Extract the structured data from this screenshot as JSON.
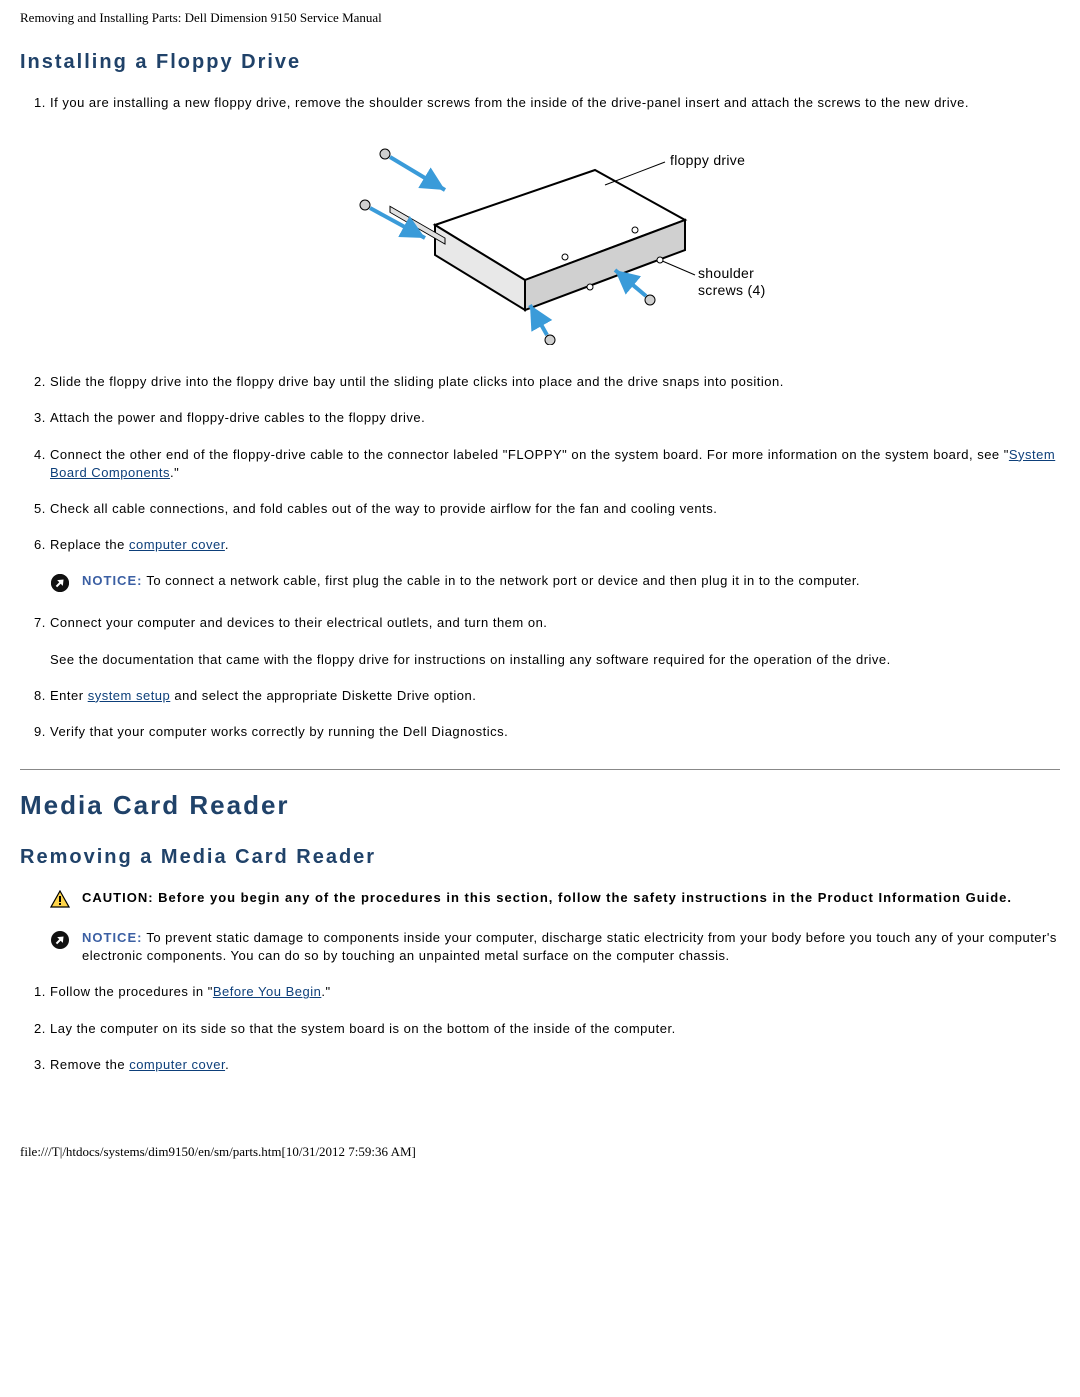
{
  "header": "Removing and Installing Parts: Dell Dimension 9150 Service Manual",
  "section1": {
    "title": "Installing a Floppy Drive",
    "step1": "If you are installing a new floppy drive, remove the shoulder screws from the inside of the drive-panel insert and attach the screws to the new drive.",
    "fig_label_floppy": "floppy drive",
    "fig_label_screws1": "shoulder",
    "fig_label_screws2": "screws (4)",
    "step2": "Slide the floppy drive into the floppy drive bay until the sliding plate clicks into place and the drive snaps into position.",
    "step3": "Attach the power and floppy-drive cables to the floppy drive.",
    "step4a": "Connect the other end of the floppy-drive cable to the connector labeled \"FLOPPY\" on the system board. For more information on the system board, see \"",
    "step4_link": "System Board Components",
    "step4b": ".\"",
    "step5": "Check all cable connections, and fold cables out of the way to provide airflow for the fan and cooling vents.",
    "step6a": "Replace the ",
    "step6_link": "computer cover",
    "step6b": ".",
    "notice1_label": "NOTICE:",
    "notice1_text": " To connect a network cable, first plug the cable in to the network port or device and then plug it in to the computer.",
    "step7": "Connect your computer and devices to their electrical outlets, and turn them on.",
    "step7b": "See the documentation that came with the floppy drive for instructions on installing any software required for the operation of the drive.",
    "step8a": "Enter ",
    "step8_link": "system setup",
    "step8b": " and select the appropriate Diskette Drive option.",
    "step9": "Verify that your computer works correctly by running the Dell Diagnostics."
  },
  "section2": {
    "major": "Media Card Reader",
    "title": "Removing a Media Card Reader",
    "caution_label": "CAUTION: ",
    "caution_text": "Before you begin any of the procedures in this section, follow the safety instructions in the Product Information Guide.",
    "notice_label": "NOTICE:",
    "notice_text": " To prevent static damage to components inside your computer, discharge static electricity from your body before you touch any of your computer's electronic components. You can do so by touching an unpainted metal surface on the computer chassis.",
    "step1a": "Follow the procedures in \"",
    "step1_link": "Before You Begin",
    "step1b": ".\"",
    "step2": "Lay the computer on its side so that the system board is on the bottom of the inside of the computer.",
    "step3a": "Remove the ",
    "step3_link": "computer cover",
    "step3b": "."
  },
  "footer": "file:///T|/htdocs/systems/dim9150/en/sm/parts.htm[10/31/2012 7:59:36 AM]"
}
